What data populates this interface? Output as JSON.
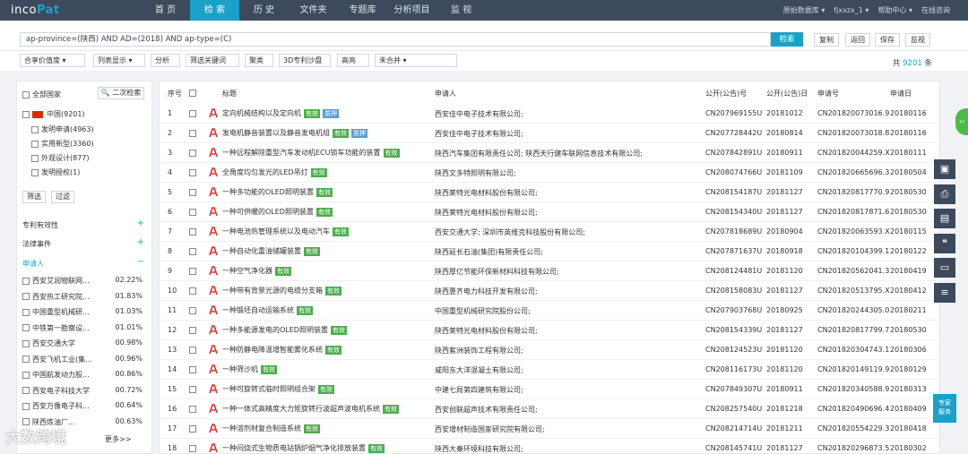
{
  "app": {
    "logo_prefix": "inco",
    "logo_suffix": "Pat"
  },
  "nav": [
    "首 页",
    "检 索",
    "历 史",
    "文件夹",
    "专题库",
    "分析项目",
    "监 视"
  ],
  "top_right": [
    "原始数据库 ▾",
    "fjxxzx_1 ▾",
    "帮助中心 ▾",
    "在线咨询"
  ],
  "search": {
    "query": "ap-province=(陕西) AND AD=(2018) AND ap-type=(C)",
    "search_label": "检索",
    "copy": "复制",
    "back": "返回",
    "save": "保存",
    "monitor": "监视"
  },
  "tools": [
    "合享价值度 ▾",
    "列表显示 ▾",
    "分析",
    "筛选关键词",
    "聚类",
    "3D专利沙盘",
    "高亮",
    "未合并 ▾"
  ],
  "total": {
    "prefix": "共",
    "count": "9201",
    "suffix": "条"
  },
  "left": {
    "all_countries": "全部国家",
    "second_search": "二次检索",
    "china": "中国(9201)",
    "types": [
      "发明申请(4963)",
      "实用新型(3360)",
      "外观设计(877)",
      "发明授权(1)"
    ],
    "filter": "筛选",
    "exclude": "过滤",
    "sections": [
      "专利有效性",
      "法律事件",
      "申请人"
    ],
    "applicants": [
      {
        "name": "西安艾润物联网...",
        "pct": "02.22%"
      },
      {
        "name": "西安热工研究院...",
        "pct": "01.83%"
      },
      {
        "name": "中国重型机械研...",
        "pct": "01.03%"
      },
      {
        "name": "中铁第一勘察设...",
        "pct": "01.01%"
      },
      {
        "name": "西安交通大学",
        "pct": "00.98%"
      },
      {
        "name": "西安飞机工业(集...",
        "pct": "00.96%"
      },
      {
        "name": "中国航发动力股...",
        "pct": "00.86%"
      },
      {
        "name": "西安电子科技大学",
        "pct": "00.72%"
      },
      {
        "name": "西安万像电子科...",
        "pct": "00.64%"
      },
      {
        "name": "陕西炼油厂...",
        "pct": "00.63%"
      }
    ],
    "more": "更多>>"
  },
  "table": {
    "headers": [
      "序号",
      "标题",
      "申请人",
      "公开(公告)号",
      "公开(公告)日",
      "申请号",
      "申请日"
    ],
    "rows": [
      {
        "no": "1",
        "title": "定向机械结构以及定向机",
        "tags": [
          [
            "有效",
            "#4cae4c"
          ],
          [
            "质押",
            "#5b9bd5"
          ]
        ],
        "applicant": "西安佳中电子技术有限公司;",
        "pub": "CN207969155U",
        "pubdate": "20181012",
        "appno": "CN201820073016.9",
        "appdate": "20180116"
      },
      {
        "no": "2",
        "title": "发电机静音装置以及静音发电机组",
        "tags": [
          [
            "有效",
            "#4cae4c"
          ],
          [
            "质押",
            "#5b9bd5"
          ]
        ],
        "applicant": "西安佳中电子技术有限公司;",
        "pub": "CN207728442U",
        "pubdate": "20180814",
        "appno": "CN201820073018.8",
        "appdate": "20180116"
      },
      {
        "no": "3",
        "title": "一种远程解除重型汽车发动机ECU锁车功能的装置",
        "tags": [
          [
            "有效",
            "#4cae4c"
          ]
        ],
        "applicant": "陕西汽车集团有限责任公司; 陕西天行健车联网信息技术有限公司;",
        "pub": "CN207842891U",
        "pubdate": "20180911",
        "appno": "CN201820044259.X",
        "appdate": "20180111"
      },
      {
        "no": "4",
        "title": "全角度均匀发光的LED吊灯",
        "tags": [
          [
            "有效",
            "#4cae4c"
          ]
        ],
        "applicant": "陕西文多特照明有限公司;",
        "pub": "CN208074766U",
        "pubdate": "20181109",
        "appno": "CN201820665696.3",
        "appdate": "20180504"
      },
      {
        "no": "5",
        "title": "一种多功能的OLED照明装置",
        "tags": [
          [
            "有效",
            "#4cae4c"
          ]
        ],
        "applicant": "陕西莱特光电材料股份有限公司;",
        "pub": "CN208154187U",
        "pubdate": "20181127",
        "appno": "CN201820817770.9",
        "appdate": "20180530"
      },
      {
        "no": "6",
        "title": "一种可供暖的OLED照明装置",
        "tags": [
          [
            "有效",
            "#4cae4c"
          ]
        ],
        "applicant": "陕西莱特光电材料股份有限公司;",
        "pub": "CN208154340U",
        "pubdate": "20181127",
        "appno": "CN201820817871.6",
        "appdate": "20180530"
      },
      {
        "no": "7",
        "title": "一种电池热管理系统以及电动汽车",
        "tags": [
          [
            "有效",
            "#4cae4c"
          ]
        ],
        "applicant": "西安交通大学; 深圳市英维克科技股份有限公司;",
        "pub": "CN207818689U",
        "pubdate": "20180904",
        "appno": "CN201820063593.X",
        "appdate": "20180115"
      },
      {
        "no": "8",
        "title": "一种自动化重油储罐装置",
        "tags": [
          [
            "有效",
            "#4cae4c"
          ]
        ],
        "applicant": "陕西延长石油(集团)有限责任公司;",
        "pub": "CN207871637U",
        "pubdate": "20180918",
        "appno": "CN201820104399.1",
        "appdate": "20180122"
      },
      {
        "no": "9",
        "title": "一种空气净化器",
        "tags": [
          [
            "有效",
            "#4cae4c"
          ]
        ],
        "applicant": "陕西厚亿节能环保新材料科技有限公司;",
        "pub": "CN208124481U",
        "pubdate": "20181120",
        "appno": "CN201820562041.3",
        "appdate": "20180419"
      },
      {
        "no": "10",
        "title": "一种带有背景光源的电缆分支箱",
        "tags": [
          [
            "有效",
            "#4cae4c"
          ]
        ],
        "applicant": "陕西惠齐电力科技开发有限公司;",
        "pub": "CN208158083U",
        "pubdate": "20181127",
        "appno": "CN201820513795.X",
        "appdate": "20180412"
      },
      {
        "no": "11",
        "title": "一种锻坯自动运输系统",
        "tags": [
          [
            "有效",
            "#4cae4c"
          ]
        ],
        "applicant": "中国重型机械研究院股份公司;",
        "pub": "CN207903768U",
        "pubdate": "20180925",
        "appno": "CN201820244305.0",
        "appdate": "20180211"
      },
      {
        "no": "12",
        "title": "一种多能源发电的OLED照明装置",
        "tags": [
          [
            "有效",
            "#4cae4c"
          ]
        ],
        "applicant": "陕西莱特光电材料股份有限公司;",
        "pub": "CN208154339U",
        "pubdate": "20181127",
        "appno": "CN201820817799.7",
        "appdate": "20180530"
      },
      {
        "no": "13",
        "title": "一种防静电降温增智能雾化系统",
        "tags": [
          [
            "有效",
            "#4cae4c"
          ]
        ],
        "applicant": "陕西紫洲装饰工程有限公司;",
        "pub": "CN208124523U",
        "pubdate": "20181120",
        "appno": "CN201820304743.1",
        "appdate": "20180306"
      },
      {
        "no": "14",
        "title": "一种筛沙机",
        "tags": [
          [
            "有效",
            "#4cae4c"
          ]
        ],
        "applicant": "咸阳东大洋混凝土有限公司;",
        "pub": "CN208116173U",
        "pubdate": "20181120",
        "appno": "CN201820149119.9",
        "appdate": "20180129"
      },
      {
        "no": "15",
        "title": "一种可旋转式临时照明组合架",
        "tags": [
          [
            "有效",
            "#4cae4c"
          ]
        ],
        "applicant": "中建七局第四建筑有限公司;",
        "pub": "CN207849307U",
        "pubdate": "20180911",
        "appno": "CN201820340588.9",
        "appdate": "20180313"
      },
      {
        "no": "16",
        "title": "一种一体式高精度大力矩旋转行波超声波电机系统",
        "tags": [
          [
            "有效",
            "#4cae4c"
          ]
        ],
        "applicant": "西安创联超声技术有限责任公司;",
        "pub": "CN208257540U",
        "pubdate": "20181218",
        "appno": "CN201820490696.4",
        "appdate": "20180409"
      },
      {
        "no": "17",
        "title": "一种溶剂材复合制造系统",
        "tags": [
          [
            "有效",
            "#4cae4c"
          ]
        ],
        "applicant": "西安增材制造国家研究院有限公司;",
        "pub": "CN208214714U",
        "pubdate": "20181211",
        "appno": "CN201820554229.3",
        "appdate": "20180418"
      },
      {
        "no": "18",
        "title": "一种闷烧式生物质电站锅炉烟气净化排放装置",
        "tags": [
          [
            "有效",
            "#4cae4c"
          ]
        ],
        "applicant": "陕西大秦环境科技有限公司;",
        "pub": "CN208145741U",
        "pubdate": "20181127",
        "appno": "CN201820296873.5",
        "appdate": "20180302"
      }
    ]
  },
  "right_icons": [
    "save-icon",
    "pdf-icon",
    "document-icon",
    "quote-icon",
    "folder-icon",
    "database-icon"
  ],
  "service": {
    "line1": "专家",
    "line2": "服务"
  },
  "watermark": "大数跨境"
}
